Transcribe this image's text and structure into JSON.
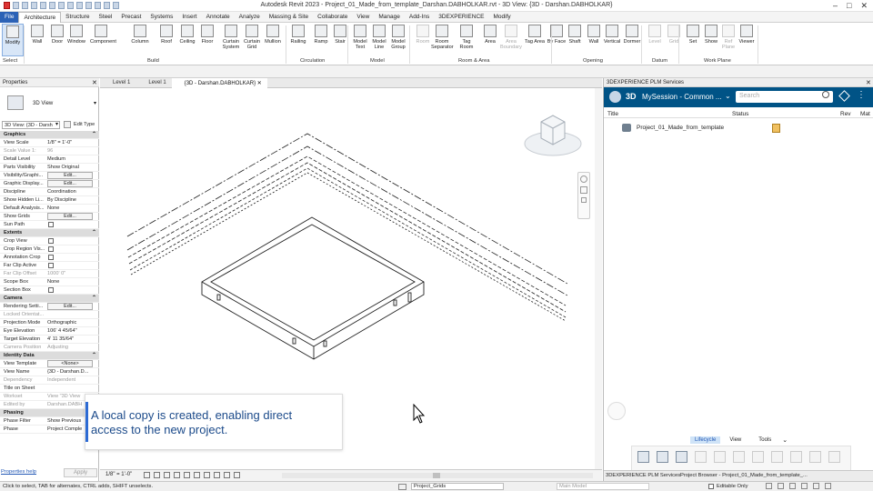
{
  "window": {
    "title": "Autodesk Revit 2023 - Project_01_Made_from_template_Darshan.DABHOLKAR.rvt - 3D View: {3D - Darshan.DABHOLKAR}"
  },
  "tabs": [
    "File",
    "Architecture",
    "Structure",
    "Steel",
    "Precast",
    "Systems",
    "Insert",
    "Annotate",
    "Analyze",
    "Massing & Site",
    "Collaborate",
    "View",
    "Manage",
    "Add-Ins",
    "3DEXPERIENCE",
    "Modify"
  ],
  "ribbon": {
    "buttons": [
      "Modify",
      "Wall",
      "Door",
      "Window",
      "Component",
      "Column",
      "Roof",
      "Ceiling",
      "Floor",
      "Curtain System",
      "Curtain Grid",
      "Mullion",
      "Railing",
      "Ramp",
      "Stair",
      "Model Text",
      "Model Line",
      "Model Group",
      "Room",
      "Room Separator",
      "Tag Room",
      "Area",
      "Area Boundary",
      "Tag Area",
      "By Face",
      "Shaft",
      "Wall",
      "Vertical",
      "Dormer",
      "Level",
      "Grid",
      "Set",
      "Show",
      "Ref Plane",
      "Viewer"
    ],
    "panels": [
      "Select",
      "Build",
      "Circulation",
      "Model",
      "Room & Area",
      "Opening",
      "Datum",
      "Work Plane"
    ]
  },
  "properties": {
    "title": "Properties",
    "type_name": "3D View",
    "selector": "3D View: {3D - Darsh",
    "edit_type": "Edit Type",
    "rows": [
      {
        "k": "Graphics",
        "sec": true
      },
      {
        "k": "View Scale",
        "v": "1/8\" = 1'-0\""
      },
      {
        "k": "Scale Value 1:",
        "v": "96",
        "g": true
      },
      {
        "k": "Detail Level",
        "v": "Medium"
      },
      {
        "k": "Parts Visibility",
        "v": "Show Original"
      },
      {
        "k": "Visibility/Graphi...",
        "b": "Edit..."
      },
      {
        "k": "Graphic Display...",
        "b": "Edit..."
      },
      {
        "k": "Discipline",
        "v": "Coordination"
      },
      {
        "k": "Show Hidden Li...",
        "v": "By Discipline"
      },
      {
        "k": "Default Analysis...",
        "v": "None"
      },
      {
        "k": "Show Grids",
        "b": "Edit..."
      },
      {
        "k": "Sun Path",
        "c": true
      },
      {
        "k": "Extents",
        "sec": true
      },
      {
        "k": "Crop View",
        "c": true
      },
      {
        "k": "Crop Region Vis...",
        "c": true
      },
      {
        "k": "Annotation Crop",
        "c": true
      },
      {
        "k": "Far Clip Active",
        "c": true
      },
      {
        "k": "Far Clip Offset",
        "v": "1000' 0\"",
        "g": true
      },
      {
        "k": "Scope Box",
        "v": "None"
      },
      {
        "k": "Section Box",
        "c": true
      },
      {
        "k": "Camera",
        "sec": true
      },
      {
        "k": "Rendering Setti...",
        "b": "Edit..."
      },
      {
        "k": "Locked Orientat...",
        "v": "",
        "g": true
      },
      {
        "k": "Projection Mode",
        "v": "Orthographic"
      },
      {
        "k": "Eye Elevation",
        "v": "106' 4 45/64\""
      },
      {
        "k": "Target Elevation",
        "v": "4' 11 35/64\""
      },
      {
        "k": "Camera Position",
        "v": "Adjusting",
        "g": true
      },
      {
        "k": "Identity Data",
        "sec": true
      },
      {
        "k": "View Template",
        "b": "<None>"
      },
      {
        "k": "View Name",
        "v": "{3D - Darshan.D..."
      },
      {
        "k": "Dependency",
        "v": "Independent",
        "g": true
      },
      {
        "k": "Title on Sheet",
        "v": ""
      },
      {
        "k": "Workset",
        "v": "View \"3D View",
        "g": true
      },
      {
        "k": "Edited by",
        "v": "Darshan.DABH",
        "g": true
      },
      {
        "k": "Phasing",
        "sec": true
      },
      {
        "k": "Phase Filter",
        "v": "Show Previous"
      },
      {
        "k": "Phase",
        "v": "Project Comple"
      }
    ],
    "help_link": "Properties help",
    "apply": "Apply"
  },
  "view_tabs": [
    "Level 1",
    "Level 1",
    "{3D - Darshan.DABHOLKAR}"
  ],
  "view_scale": "1/8\" = 1'-0\"",
  "caption": {
    "line1": "A local copy is created, enabling direct",
    "line2": "access to the new project."
  },
  "plm": {
    "panel_title": "3DEXPERIENCE PLM Services",
    "session": "MySession - Common ...",
    "search_placeholder": "Search",
    "columns": [
      "Title",
      "Status",
      "Rev",
      "Mat"
    ],
    "items": [
      {
        "title": "Project_01_Made_from_template"
      }
    ],
    "bottom_tabs": [
      "Lifecycle",
      "View",
      "Tools"
    ],
    "footer_tabs": [
      "3DEXPERIENCE PLM Services",
      "Project Browser - Project_01_Made_from_template_..."
    ]
  },
  "statusbar": {
    "hint": "Click to select, TAB for alternates, CTRL adds, SHIFT unselects.",
    "workset": "Project_Grids",
    "model": "Main Model",
    "editable": "Editable Only"
  },
  "colors": {
    "file_tab": "#2c62b6",
    "plm_header": "#005386",
    "caption_text": "#1b4a8a"
  }
}
